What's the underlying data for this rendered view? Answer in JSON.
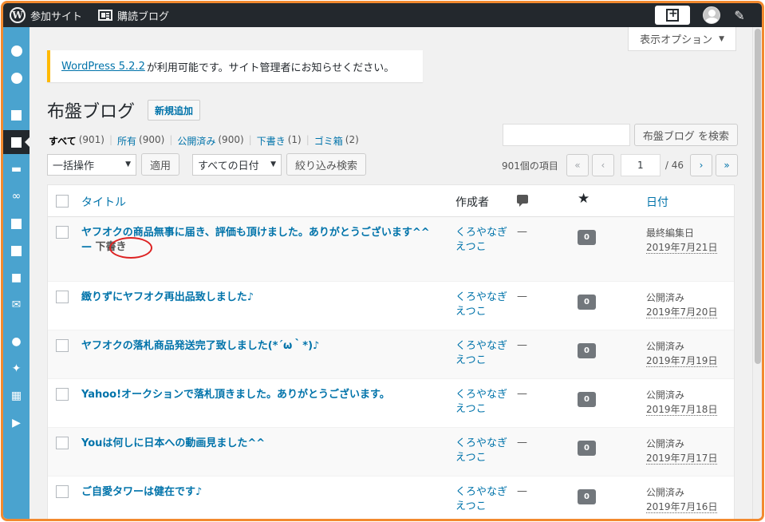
{
  "adminbar": {
    "site_label": "参加サイト",
    "reader_label": "購読ブログ"
  },
  "screen_options": "表示オプション",
  "notice": {
    "link": "WordPress 5.2.2",
    "text": " が利用可能です。サイト管理者にお知らせください。"
  },
  "page": {
    "title": "布盤ブログ",
    "add_new": "新規追加"
  },
  "filters": [
    {
      "label": "すべて",
      "count": "(901)",
      "current": true
    },
    {
      "label": "所有",
      "count": "(900)",
      "current": false
    },
    {
      "label": "公開済み",
      "count": "(900)",
      "current": false
    },
    {
      "label": "下書き",
      "count": "(1)",
      "current": false
    },
    {
      "label": "ゴミ箱",
      "count": "(2)",
      "current": false
    }
  ],
  "search": {
    "button": "布盤ブログ を検索",
    "value": ""
  },
  "tablenav": {
    "bulk_action": "一括操作",
    "apply": "適用",
    "date_filter": "すべての日付",
    "filter_button": "絞り込み検索"
  },
  "pagination": {
    "items": "901個の項目",
    "first": "«",
    "prev": "‹",
    "current_page": "1",
    "total": "/ 46",
    "next": "›",
    "last": "»"
  },
  "table": {
    "col_title": "タイトル",
    "col_author": "作成者",
    "col_date": "日付",
    "rows": [
      {
        "title": "ヤフオクの商品無事に届き、評価も頂けました。ありがとうございます^^",
        "state": "下書き",
        "author": "くろやなぎえつこ",
        "tags": "—",
        "comments": "0",
        "status": "最終編集日",
        "date": "2019年7月21日"
      },
      {
        "title": "緻りずにヤフオク再出品致しました♪",
        "state": "",
        "author": "くろやなぎえつこ",
        "tags": "—",
        "comments": "0",
        "status": "公開済み",
        "date": "2019年7月20日"
      },
      {
        "title": "ヤフオクの落札商品発送完了致しました(*´ω｀*)♪",
        "state": "",
        "author": "くろやなぎえつこ",
        "tags": "—",
        "comments": "0",
        "status": "公開済み",
        "date": "2019年7月19日"
      },
      {
        "title": "Yahoo!オークションで落札頂きました。ありがとうございます。",
        "state": "",
        "author": "くろやなぎえつこ",
        "tags": "—",
        "comments": "0",
        "status": "公開済み",
        "date": "2019年7月18日"
      },
      {
        "title": "Youは何しに日本への動画見ました^^",
        "state": "",
        "author": "くろやなぎえつこ",
        "tags": "—",
        "comments": "0",
        "status": "公開済み",
        "date": "2019年7月17日"
      },
      {
        "title": "ご自愛タワーは健在です♪",
        "state": "",
        "author": "くろやなぎえつこ",
        "tags": "—",
        "comments": "0",
        "status": "公開済み",
        "date": "2019年7月16日"
      }
    ]
  },
  "colors": {
    "admin_bar": "#23282d",
    "sidebar": "#4aa3cf",
    "link": "#0073aa",
    "frame": "#f28a2f",
    "notice_border": "#ffb900"
  }
}
